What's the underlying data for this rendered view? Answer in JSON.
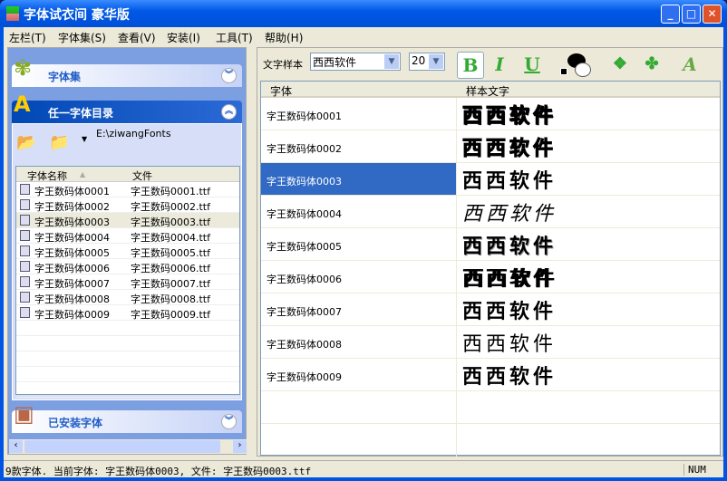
{
  "window": {
    "title": "字体试衣间  豪华版",
    "min": "_",
    "max": "□",
    "close": "✕"
  },
  "menu": [
    "左栏(T)",
    "字体集(S)",
    "查看(V)",
    "安装(I)",
    "工具(T)",
    "帮助(H)"
  ],
  "left": {
    "group1": "字体集",
    "group2": "任一字体目录",
    "group3": "已安装字体",
    "path": "E:\\ziwangFonts",
    "columns": [
      "字体名称",
      "文件"
    ],
    "rows": [
      [
        "字王数码体0001",
        "字王数码0001.ttf"
      ],
      [
        "字王数码体0002",
        "字王数码0002.ttf"
      ],
      [
        "字王数码体0003",
        "字王数码0003.ttf"
      ],
      [
        "字王数码体0004",
        "字王数码0004.ttf"
      ],
      [
        "字王数码体0005",
        "字王数码0005.ttf"
      ],
      [
        "字王数码体0006",
        "字王数码0006.ttf"
      ],
      [
        "字王数码体0007",
        "字王数码0007.ttf"
      ],
      [
        "字王数码体0008",
        "字王数码0008.ttf"
      ],
      [
        "字王数码体0009",
        "字王数码0009.ttf"
      ]
    ]
  },
  "toolbar": {
    "sample_label": "文字样本",
    "sample_value": "西西软件",
    "size": "20",
    "bold": "B",
    "italic": "I",
    "underline": "U"
  },
  "grid": {
    "columns": [
      "字体",
      "样本文字"
    ],
    "selected_index": 2,
    "rows": [
      {
        "name": "字王数码体0001",
        "sample": "西西软件"
      },
      {
        "name": "字王数码体0002",
        "sample": "西西软件"
      },
      {
        "name": "字王数码体0003",
        "sample": "西西软件"
      },
      {
        "name": "字王数码体0004",
        "sample": "西西软件"
      },
      {
        "name": "字王数码体0005",
        "sample": "西西软件"
      },
      {
        "name": "字王数码体0006",
        "sample": "西西软件"
      },
      {
        "name": "字王数码体0007",
        "sample": "西西软件"
      },
      {
        "name": "字王数码体0008",
        "sample": "西西软件"
      },
      {
        "name": "字王数码体0009",
        "sample": "西西软件"
      }
    ]
  },
  "status": {
    "text": "9款字体.  当前字体: 字王数码体0003, 文件: 字王数码0003.ttf",
    "num": "NUM"
  }
}
